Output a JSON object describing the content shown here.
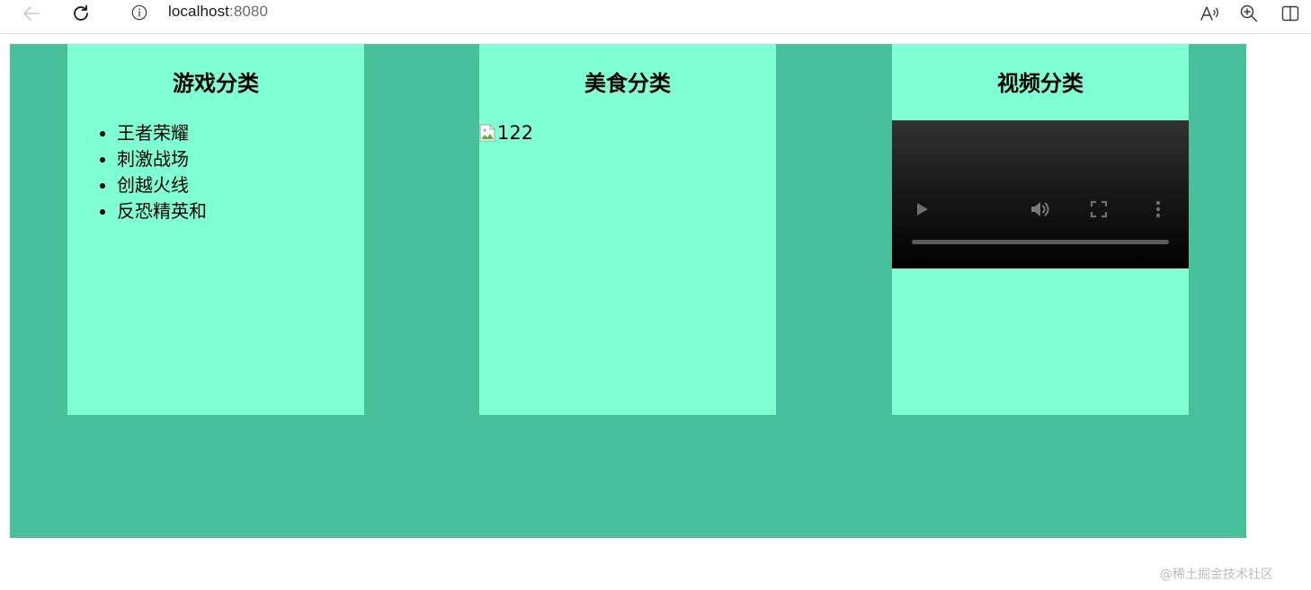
{
  "browser": {
    "url_host": "localhost",
    "url_port": ":8080",
    "icons": [
      "back-arrow-icon",
      "reload-icon",
      "info-icon",
      "read-aloud-icon",
      "zoom-in-icon",
      "split-screen-icon"
    ]
  },
  "colors": {
    "container_bg": "#48c19a",
    "panel_bg": "#80ffd4"
  },
  "panels": [
    {
      "title": "游戏分类",
      "items": [
        "王者荣耀",
        "刺激战场",
        "创越火线",
        "反恐精英和"
      ]
    },
    {
      "title": "美食分类",
      "image_alt": "122"
    },
    {
      "title": "视频分类",
      "video_controls": [
        "play-icon",
        "volume-icon",
        "fullscreen-icon",
        "more-options-icon"
      ]
    }
  ],
  "watermark": "@稀土掘金技术社区"
}
